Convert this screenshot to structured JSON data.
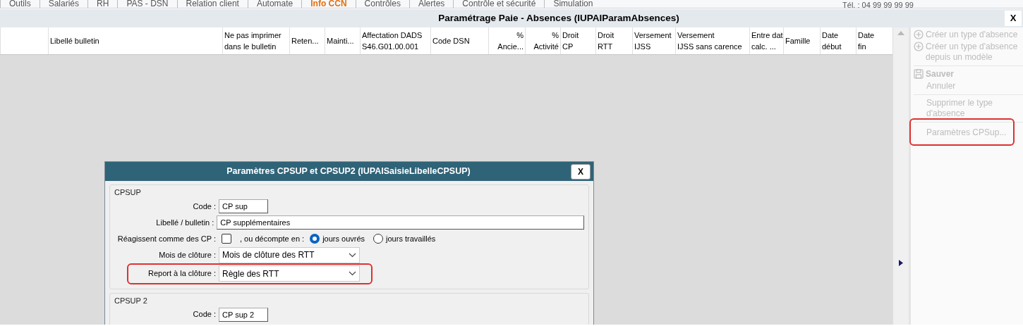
{
  "menu": {
    "items": [
      {
        "label": "Outils",
        "selected": false
      },
      {
        "label": "Salariés",
        "selected": false
      },
      {
        "label": "RH",
        "selected": false
      },
      {
        "label": "PAS - DSN",
        "selected": false
      },
      {
        "label": "Relation client",
        "selected": false
      },
      {
        "label": "Automate",
        "selected": false
      },
      {
        "label": "Info CCN",
        "selected": true
      },
      {
        "label": "Contrôles",
        "selected": false
      },
      {
        "label": "Alertes",
        "selected": false
      },
      {
        "label": "Contrôle et sécurité",
        "selected": false
      },
      {
        "label": "Simulation",
        "selected": false
      }
    ],
    "phone": "Tél. : 04 99 99 99 99"
  },
  "window": {
    "title": "Paramétrage Paie - Absences (IUPAIParamAbsences)",
    "close": "X"
  },
  "table": {
    "columns": [
      {
        "kind": "text",
        "lines": [
          "Libellé bulletin"
        ]
      },
      {
        "kind": "text",
        "lines": [
          "Ne pas imprimer",
          "dans le bulletin"
        ]
      },
      {
        "kind": "text",
        "lines": [
          "Reten..."
        ]
      },
      {
        "kind": "text",
        "lines": [
          "Mainti..."
        ]
      },
      {
        "kind": "text",
        "lines": [
          "Affectation DADS",
          "S46.G01.00.001"
        ]
      },
      {
        "kind": "text",
        "lines": [
          "Code DSN"
        ]
      },
      {
        "kind": "numeric",
        "lines": [
          "%",
          "Ancie..."
        ]
      },
      {
        "kind": "numeric",
        "lines": [
          "%",
          "Activité"
        ]
      },
      {
        "kind": "text",
        "lines": [
          "Droit",
          "CP"
        ]
      },
      {
        "kind": "text",
        "lines": [
          "Droit",
          "RTT"
        ]
      },
      {
        "kind": "text",
        "lines": [
          "Versement",
          "IJSS"
        ]
      },
      {
        "kind": "text",
        "lines": [
          "Versement",
          "IJSS sans carence"
        ]
      },
      {
        "kind": "text",
        "lines": [
          "Entre dat",
          "calc. ..."
        ]
      },
      {
        "kind": "text",
        "lines": [
          "Famille"
        ]
      },
      {
        "kind": "text",
        "lines": [
          "Date",
          "début"
        ]
      },
      {
        "kind": "text",
        "lines": [
          "Date",
          "fin"
        ]
      }
    ]
  },
  "actions": [
    {
      "kind": "add-action",
      "label": "Créer un type d'absence",
      "disabled": true,
      "highlighted": false
    },
    {
      "kind": "add-action",
      "label": "Créer un type d'absence depuis un modèle",
      "disabled": true,
      "highlighted": false
    },
    {
      "kind": "divider"
    },
    {
      "kind": "save-action",
      "label": "Sauver",
      "disabled": true,
      "highlighted": false
    },
    {
      "kind": "action",
      "label": "Annuler",
      "disabled": true,
      "highlighted": false
    },
    {
      "kind": "divider"
    },
    {
      "kind": "action",
      "label": "Supprimer le type d'absence",
      "disabled": true,
      "highlighted": false
    },
    {
      "kind": "divider"
    },
    {
      "kind": "action",
      "label": "Paramètres CPSup...",
      "disabled": true,
      "highlighted": true
    }
  ],
  "dialog": {
    "title": "Paramètres CPSUP et CPSUP2 (IUPAISaisieLibelleCPSUP)",
    "close": "X",
    "groups": [
      {
        "legend": "CPSUP",
        "fields": [
          {
            "kind": "short-text",
            "label": "Code :",
            "value": "CP sup"
          },
          {
            "kind": "text",
            "label": "Libellé / bulletin :",
            "value": "CP supplémentaires"
          },
          {
            "kind": "options",
            "label": "Réagissent comme des CP :",
            "checked": false,
            "sublabel": ", ou décompte en :",
            "choices": [
              {
                "label": "jours ouvrés",
                "selected": true
              },
              {
                "label": "jours travaillés",
                "selected": false
              }
            ]
          },
          {
            "kind": "select",
            "label": "Mois de clôture :",
            "value": "Mois de clôture des RTT",
            "highlighted": false
          },
          {
            "kind": "select",
            "label": "Report à la clôture :",
            "value": "Règle des RTT",
            "highlighted": true
          }
        ]
      },
      {
        "legend": "CPSUP 2",
        "fields": [
          {
            "kind": "short-text",
            "label": "Code :",
            "value": "CP sup 2"
          }
        ]
      }
    ]
  }
}
